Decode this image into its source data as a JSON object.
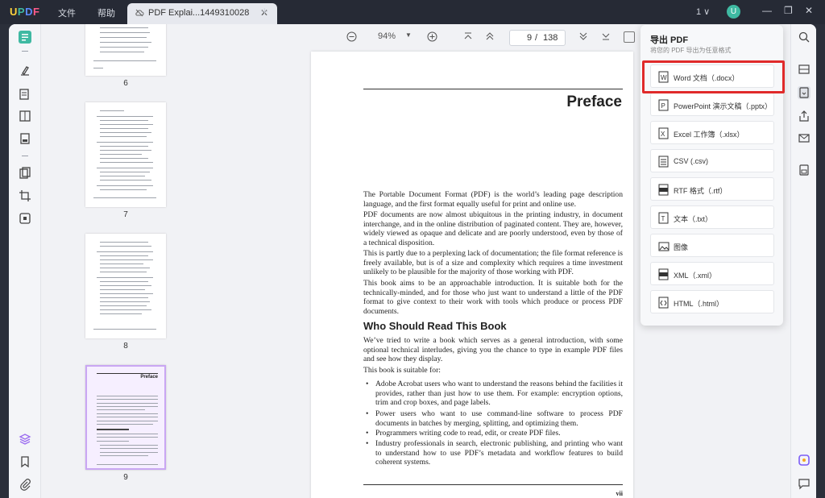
{
  "titlebar": {
    "logo": "UPDF",
    "menu_file": "文件",
    "menu_help": "帮助",
    "tab_title": "PDF Explai...1449310028",
    "tab_close": "✕",
    "new_tab": "+",
    "page_switch": "1 ∨",
    "avatar": "U"
  },
  "toolbar": {
    "zoom": "94%",
    "current_page": "9",
    "page_separator": "/",
    "total_pages": "138"
  },
  "thumbnails": [
    {
      "label": "6"
    },
    {
      "label": "7"
    },
    {
      "label": "8"
    },
    {
      "label": "9",
      "selected": true
    }
  ],
  "document": {
    "heading": "Preface",
    "paragraphs": [
      "The Portable Document Format (PDF) is the world’s leading page description language, and the first format equally useful for print and online use.",
      "PDF documents are now almost ubiquitous in the printing industry, in document interchange, and in the online distribution of paginated content. They are, however, widely viewed as opaque and delicate and are poorly understood, even by those of a technical disposition.",
      "This is partly due to a perplexing lack of documentation; the file format reference is freely available, but is of a size and complexity which requires a time investment unlikely to be plausible for the majority of those working with PDF.",
      "This book aims to be an approachable introduction. It is suitable both for the technically-minded, and for those who just want to understand a little of the PDF format to give context to their work with tools which produce or process PDF documents."
    ],
    "section_heading": "Who Should Read This Book",
    "section_paragraphs": [
      "We’ve tried to write a book which serves as a general introduction, with some optional technical interludes, giving you the chance to type in example PDF files and see how they display.",
      "This book is suitable for:"
    ],
    "bullets": [
      "Adobe Acrobat users who want to understand the reasons behind the facilities it provides, rather than just how to use them. For example: encryption options, trim and crop boxes, and page labels.",
      "Power users who want to use command-line software to process PDF documents in batches by merging, splitting, and optimizing them.",
      "Programmers writing code to read, edit, or create PDF files.",
      "Industry professionals in search, electronic publishing, and printing who want to understand how to use PDF’s metadata and workflow features to build coherent systems."
    ],
    "page_number": "vii"
  },
  "export_popup": {
    "title": "导出 PDF",
    "subtitle": "将您的 PDF 导出为任意格式",
    "options": [
      {
        "label": "Word 文档（.docx）",
        "icon": "word-icon",
        "highlighted": true
      },
      {
        "label": "PowerPoint 演示文稿（.pptx）",
        "icon": "powerpoint-icon"
      },
      {
        "label": "Excel 工作簿（.xlsx）",
        "icon": "excel-icon"
      },
      {
        "label": "CSV (.csv)",
        "icon": "csv-icon"
      },
      {
        "label": "RTF 格式（.rtf）",
        "icon": "rtf-icon"
      },
      {
        "label": "文本（.txt）",
        "icon": "text-icon"
      },
      {
        "label": "图像",
        "icon": "image-icon"
      },
      {
        "label": "XML（.xml）",
        "icon": "xml-icon"
      },
      {
        "label": "HTML（.html）",
        "icon": "html-icon"
      }
    ]
  },
  "colors": {
    "accent": "#3fb9a2",
    "highlight_border": "#e02a2a",
    "titlebar_bg": "#262a35"
  }
}
